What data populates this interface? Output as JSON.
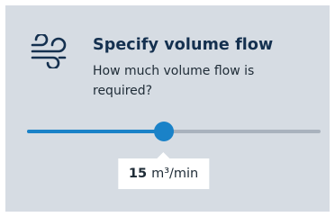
{
  "card": {
    "icon": "wind-icon",
    "title": "Specify volume flow",
    "subtitle": "How much volume flow is required?"
  },
  "slider": {
    "fraction": 0.465,
    "value": "15",
    "unit": "m³/min"
  },
  "colors": {
    "background": "#d6dce3",
    "title": "#14304f",
    "accent": "#1a82c8",
    "track": "#a9b2bd"
  }
}
